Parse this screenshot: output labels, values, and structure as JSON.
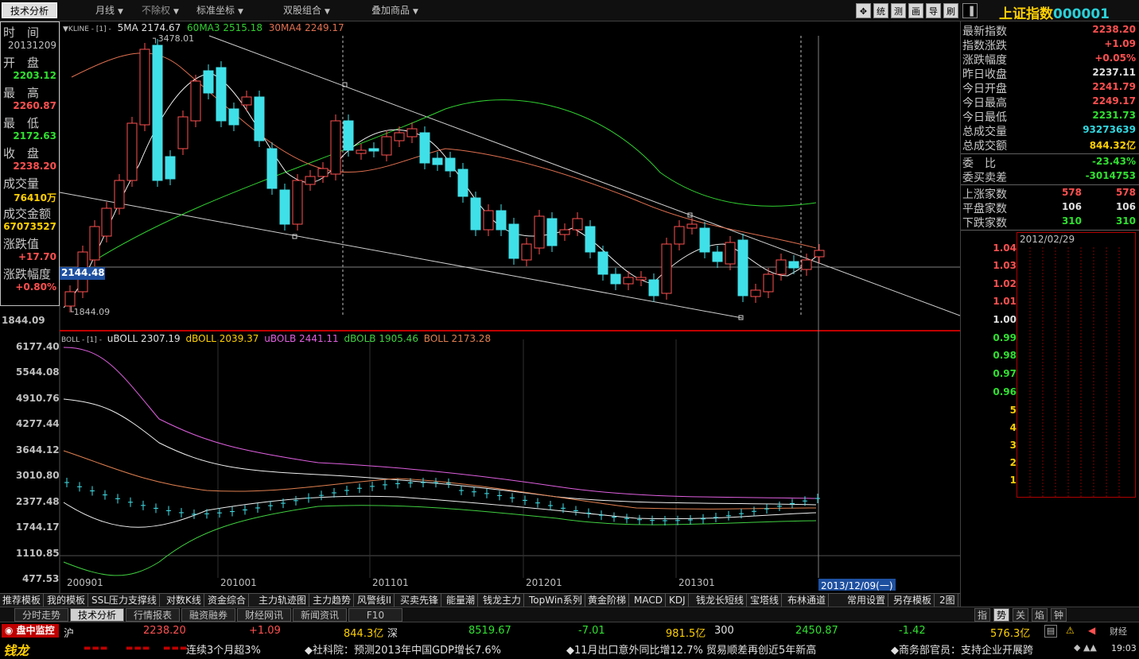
{
  "toolbar": {
    "tech_analysis": "技术分析",
    "period": "月线",
    "rights": "不除权",
    "coord": "标准坐标",
    "dual": "双股组合",
    "overlay": "叠加商品",
    "tools": [
      "✥",
      "统",
      "测",
      "画",
      "导",
      "刷"
    ],
    "title_name": "上证指数",
    "title_code": "000001"
  },
  "info": {
    "time_label": "时　间",
    "time_value": "20131209",
    "open_label": "开　盘",
    "open_value": "2203.12",
    "high_label": "最　高",
    "high_value": "2260.87",
    "low_label": "最　低",
    "low_value": "2172.63",
    "close_label": "收　盘",
    "close_value": "2238.20",
    "volume_label": "成交量",
    "volume_value": "76410万",
    "amount_label": "成交金额",
    "amount_value": "67073527",
    "change_label": "涨跌值",
    "change_value": "+17.70",
    "pct_label": "涨跌幅度",
    "pct_value": "+0.80%"
  },
  "kline_legend": {
    "title": "▼KLINE - [1] -",
    "ma5": "5MA 2174.67",
    "ma60": "60MA3 2515.18",
    "ma30": "30MA4 2249.17",
    "high_mark": "3478.01",
    "low_mark": "1844.09",
    "cursor_price": "2144.48",
    "low_axis": "1844.09"
  },
  "boll_legend": {
    "title": "BOLL - [1] -",
    "uboll": "uBOLL 2307.19",
    "dboll": "dBOLL 2039.37",
    "ubolb": "uBOLB 2441.11",
    "dbolb": "dBOLB 1905.46",
    "boll": "BOLL 2173.28"
  },
  "boll_axis": [
    "6177.40",
    "5544.08",
    "4910.76",
    "4277.44",
    "3644.12",
    "3010.80",
    "2377.48",
    "1744.17",
    "1110.85",
    "477.53"
  ],
  "x_labels": [
    "200901",
    "201001",
    "201101",
    "201201",
    "201301"
  ],
  "cursor_date": "2013/12/09(一)",
  "right_panel": {
    "rows": [
      {
        "label": "最新指数",
        "value": "2238.20",
        "color": "red"
      },
      {
        "label": "指数涨跌",
        "value": "+1.09",
        "color": "red"
      },
      {
        "label": "涨跌幅度",
        "value": "+0.05%",
        "color": "red"
      },
      {
        "label": "昨日收盘",
        "value": "2237.11",
        "color": "wht"
      },
      {
        "label": "今日开盘",
        "value": "2241.79",
        "color": "red"
      },
      {
        "label": "今日最高",
        "value": "2249.17",
        "color": "red"
      },
      {
        "label": "今日最低",
        "value": "2231.73",
        "color": "grn"
      },
      {
        "label": "总成交量",
        "value": "93273639",
        "color": "cyan"
      },
      {
        "label": "总成交额",
        "value": "844.32亿",
        "color": "yel"
      }
    ],
    "ratio_label": "委　比",
    "ratio_value": "-23.43%",
    "diff_label": "委买卖差",
    "diff_value": "-3014753",
    "up_label": "上涨家数",
    "up_a": "578",
    "up_b": "578",
    "flat_label": "平盘家数",
    "flat_a": "106",
    "flat_b": "106",
    "down_label": "下跌家数",
    "down_a": "310",
    "down_b": "310",
    "ratio_date": "2012/02/29",
    "ratio_levels": [
      {
        "t": "1.04",
        "c": "red"
      },
      {
        "t": "1.03",
        "c": "red"
      },
      {
        "t": "1.02",
        "c": "red"
      },
      {
        "t": "1.01",
        "c": "red"
      },
      {
        "t": "1.00",
        "c": "wht"
      },
      {
        "t": "0.99",
        "c": "grn"
      },
      {
        "t": "0.98",
        "c": "grn"
      },
      {
        "t": "0.97",
        "c": "grn"
      },
      {
        "t": "0.96",
        "c": "grn"
      },
      {
        "t": "5",
        "c": "yel"
      },
      {
        "t": "4",
        "c": "yel"
      },
      {
        "t": "3",
        "c": "yel"
      },
      {
        "t": "2",
        "c": "yel"
      },
      {
        "t": "1",
        "c": "yel"
      }
    ]
  },
  "tabs": [
    "推荐模板",
    "我的模板",
    "SSL压力支撑线",
    "对数K线",
    "资金综合",
    "主力轨迹图",
    "主力趋势",
    "风警线II",
    "买卖先锋",
    "能量潮",
    "钱龙主力",
    "TopWin系列",
    "黄金阶梯",
    "MACD",
    "KDJ",
    "钱龙长短线",
    "宝塔线",
    "布林通道",
    "常用设置",
    "另存模板",
    "2图"
  ],
  "tabs2": [
    "分时走势",
    "技术分析",
    "行情报表",
    "融资融券",
    "财经网讯",
    "新闻资讯",
    "F10"
  ],
  "rp_buttons": [
    "指",
    "势",
    "关",
    "焰",
    "钟"
  ],
  "ticker": {
    "monitor": "盘中监控",
    "sh_label": "沪",
    "sh_price": "2238.20",
    "sh_chg": "+1.09",
    "sh_amt": "844.3亿",
    "sz_label": "深",
    "sz_price": "8519.67",
    "sz_chg": "-7.01",
    "sz_amt": "981.5亿",
    "hs_label": "300",
    "hs_price": "2450.87",
    "hs_chg": "-1.42",
    "hs_amt": "576.3亿",
    "news1": "连续3个月超3%",
    "news2": "◆社科院：预测2013年中国GDP增长7.6%",
    "news3": "◆11月出口意外同比增12.7% 贸易顺差再创近5年新高",
    "news4": "◆商务部官员：支持企业开展跨",
    "logo": "钱龙",
    "right_tag": "财经",
    "clock": "19:03"
  }
}
